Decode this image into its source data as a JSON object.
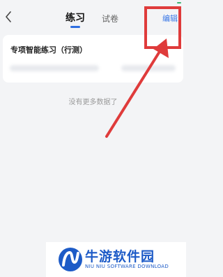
{
  "nav": {
    "tabs": [
      {
        "label": "练习",
        "active": true
      },
      {
        "label": "试卷",
        "active": false
      }
    ],
    "edit_label": "编辑",
    "back_icon": "chevron-left-icon"
  },
  "card": {
    "title": "专项智能练习（行测）"
  },
  "empty_message": "没有更多数据了",
  "watermark": {
    "name": "牛游软件园",
    "subtitle": "NIU NIU SOFTWARE DOWNLOAD"
  },
  "colors": {
    "accent": "#2f6fe0",
    "edit_link": "#3a78e6",
    "annotation": "#df3b3b",
    "background": "#f3f4f6"
  }
}
